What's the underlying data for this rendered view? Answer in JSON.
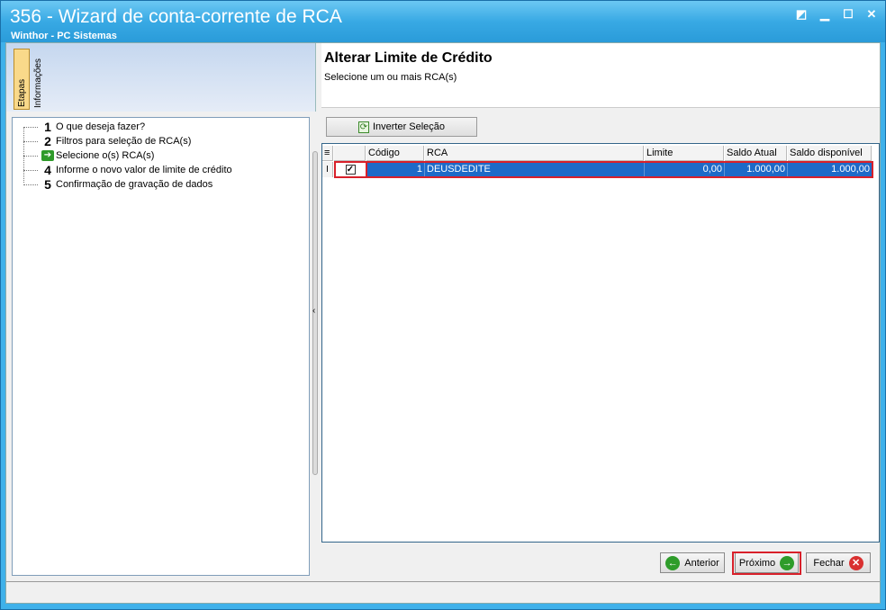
{
  "window": {
    "title": "356 - Wizard de conta-corrente de RCA",
    "subtitle": "Winthor - PC Sistemas"
  },
  "left": {
    "tabs": [
      "Etapas",
      "Informações"
    ],
    "steps": [
      {
        "num": "1",
        "label": "O que deseja fazer?"
      },
      {
        "num": "2",
        "label": "Filtros para seleção de RCA(s)"
      },
      {
        "num": "",
        "label": "Selecione o(s) RCA(s)",
        "current": true
      },
      {
        "num": "4",
        "label": "Informe o novo valor de limite de crédito"
      },
      {
        "num": "5",
        "label": "Confirmação de gravação de dados"
      }
    ]
  },
  "main": {
    "heading": "Alterar Limite de Crédito",
    "instruction": "Selecione um ou mais RCA(s)",
    "invert_button": "Inverter Seleção",
    "grid": {
      "columns": [
        "Código",
        "RCA",
        "Limite",
        "Saldo Atual",
        "Saldo disponível"
      ],
      "rows": [
        {
          "selected": true,
          "codigo": "1",
          "rca": "DEUSDEDITE",
          "limite": "0,00",
          "saldo_atual": "1.000,00",
          "saldo_disponivel": "1.000,00"
        }
      ]
    }
  },
  "buttons": {
    "anterior": "Anterior",
    "proximo": "Próximo",
    "fechar": "Fechar"
  },
  "icons": [
    "restore-icon",
    "minimize-icon",
    "maximize-icon",
    "close-icon",
    "arrow-left-icon",
    "arrow-right-icon",
    "close-circle-icon",
    "invert-selection-icon"
  ],
  "colors": {
    "title_bar": "#38a9e4",
    "selected_row": "#1d6ac8",
    "highlight": "#d8202a",
    "green_icon": "#2e9c2a"
  }
}
